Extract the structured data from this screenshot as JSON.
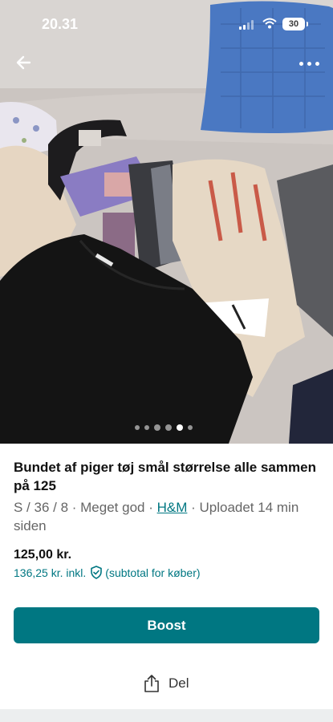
{
  "status_bar": {
    "time": "20.31",
    "battery": "30"
  },
  "photo": {
    "description_icon": "listing-photo",
    "pager": {
      "count": 6,
      "active_index": 4
    }
  },
  "listing": {
    "title": "Bundet af piger tøj smål størrelse  alle sammen på 125",
    "meta_prefix": "S / 36 / 8 · Meget god · ",
    "brand": "H&M",
    "meta_suffix": " · Uploadet 14 min siden",
    "price": "125,00 kr.",
    "price_incl_amount": "136,25 kr. inkl.",
    "price_incl_note": "(subtotal for køber)"
  },
  "actions": {
    "boost_label": "Boost",
    "share_label": "Del"
  },
  "colors": {
    "accent": "#007782"
  }
}
